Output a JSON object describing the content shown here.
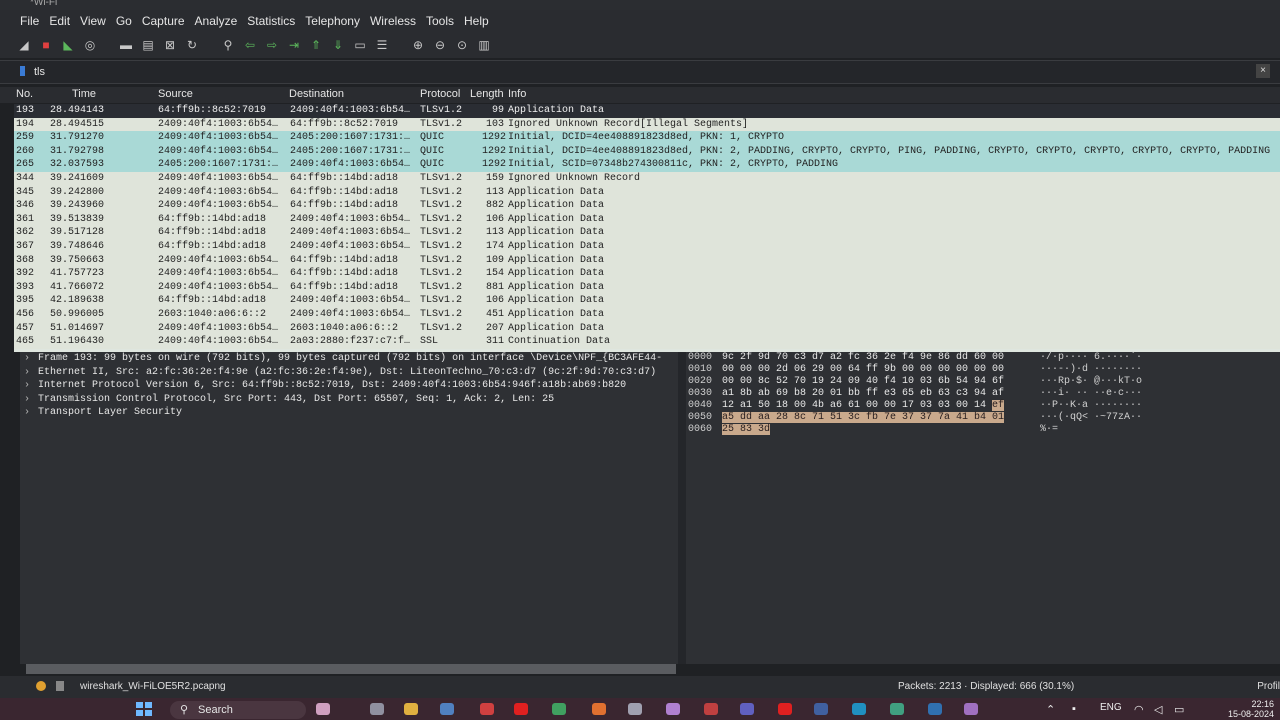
{
  "window": {
    "title": "*Wi-Fi"
  },
  "menu": [
    "File",
    "Edit",
    "View",
    "Go",
    "Capture",
    "Analyze",
    "Statistics",
    "Telephony",
    "Wireless",
    "Tools",
    "Help"
  ],
  "toolbar_icons": [
    "shark-fin-icon",
    "stop-icon",
    "restart-icon",
    "options-icon",
    "open-icon",
    "save-icon",
    "close-file-icon",
    "reload-icon",
    "find-icon",
    "back-icon",
    "forward-icon",
    "goto-icon",
    "first-icon",
    "last-icon",
    "autoscroll-icon",
    "colorize-icon",
    "zoom-in-icon",
    "zoom-out-icon",
    "zoom-reset-icon",
    "resize-columns-icon"
  ],
  "filter": {
    "value": "tls"
  },
  "columns": {
    "no": "No.",
    "time": "Time",
    "source": "Source",
    "destination": "Destination",
    "protocol": "Protocol",
    "length": "Length",
    "info": "Info"
  },
  "packets": [
    {
      "no": "193",
      "time": "28.494143",
      "src": "64:ff9b::8c52:7019",
      "dst": "2409:40f4:1003:6b54…",
      "proto": "TLSv1.2",
      "len": "99",
      "info": "Application Data",
      "type": "sel"
    },
    {
      "no": "194",
      "time": "28.494515",
      "src": "2409:40f4:1003:6b54…",
      "dst": "64:ff9b::8c52:7019",
      "proto": "TLSv1.2",
      "len": "103",
      "info": "Ignored Unknown Record[Illegal Segments]",
      "type": "tls"
    },
    {
      "no": "259",
      "time": "31.791270",
      "src": "2409:40f4:1003:6b54…",
      "dst": "2405:200:1607:1731:…",
      "proto": "QUIC",
      "len": "1292",
      "info": "Initial, DCID=4ee408891823d8ed, PKN: 1, CRYPTO",
      "type": "quic"
    },
    {
      "no": "260",
      "time": "31.792798",
      "src": "2409:40f4:1003:6b54…",
      "dst": "2405:200:1607:1731:…",
      "proto": "QUIC",
      "len": "1292",
      "info": "Initial, DCID=4ee408891823d8ed, PKN: 2, PADDING, CRYPTO, CRYPTO, PING, PADDING, CRYPTO, CRYPTO, CRYPTO, CRYPTO, CRYPTO, PADDING",
      "type": "quic"
    },
    {
      "no": "265",
      "time": "32.037593",
      "src": "2405:200:1607:1731:…",
      "dst": "2409:40f4:1003:6b54…",
      "proto": "QUIC",
      "len": "1292",
      "info": "Initial, SCID=07348b274300811c, PKN: 2, CRYPTO, PADDING",
      "type": "quic"
    },
    {
      "no": "344",
      "time": "39.241609",
      "src": "2409:40f4:1003:6b54…",
      "dst": "64:ff9b::14bd:ad18",
      "proto": "TLSv1.2",
      "len": "159",
      "info": "Ignored Unknown Record",
      "type": "tls"
    },
    {
      "no": "345",
      "time": "39.242800",
      "src": "2409:40f4:1003:6b54…",
      "dst": "64:ff9b::14bd:ad18",
      "proto": "TLSv1.2",
      "len": "113",
      "info": "Application Data",
      "type": "tls"
    },
    {
      "no": "346",
      "time": "39.243960",
      "src": "2409:40f4:1003:6b54…",
      "dst": "64:ff9b::14bd:ad18",
      "proto": "TLSv1.2",
      "len": "882",
      "info": "Application Data",
      "type": "tls"
    },
    {
      "no": "361",
      "time": "39.513839",
      "src": "64:ff9b::14bd:ad18",
      "dst": "2409:40f4:1003:6b54…",
      "proto": "TLSv1.2",
      "len": "106",
      "info": "Application Data",
      "type": "tls"
    },
    {
      "no": "362",
      "time": "39.517128",
      "src": "64:ff9b::14bd:ad18",
      "dst": "2409:40f4:1003:6b54…",
      "proto": "TLSv1.2",
      "len": "113",
      "info": "Application Data",
      "type": "tls"
    },
    {
      "no": "367",
      "time": "39.748646",
      "src": "64:ff9b::14bd:ad18",
      "dst": "2409:40f4:1003:6b54…",
      "proto": "TLSv1.2",
      "len": "174",
      "info": "Application Data",
      "type": "tls"
    },
    {
      "no": "368",
      "time": "39.750663",
      "src": "2409:40f4:1003:6b54…",
      "dst": "64:ff9b::14bd:ad18",
      "proto": "TLSv1.2",
      "len": "109",
      "info": "Application Data",
      "type": "tls"
    },
    {
      "no": "392",
      "time": "41.757723",
      "src": "2409:40f4:1003:6b54…",
      "dst": "64:ff9b::14bd:ad18",
      "proto": "TLSv1.2",
      "len": "154",
      "info": "Application Data",
      "type": "tls"
    },
    {
      "no": "393",
      "time": "41.766072",
      "src": "2409:40f4:1003:6b54…",
      "dst": "64:ff9b::14bd:ad18",
      "proto": "TLSv1.2",
      "len": "881",
      "info": "Application Data",
      "type": "tls"
    },
    {
      "no": "395",
      "time": "42.189638",
      "src": "64:ff9b::14bd:ad18",
      "dst": "2409:40f4:1003:6b54…",
      "proto": "TLSv1.2",
      "len": "106",
      "info": "Application Data",
      "type": "tls"
    },
    {
      "no": "456",
      "time": "50.996005",
      "src": "2603:1040:a06:6::2",
      "dst": "2409:40f4:1003:6b54…",
      "proto": "TLSv1.2",
      "len": "451",
      "info": "Application Data",
      "type": "tls"
    },
    {
      "no": "457",
      "time": "51.014697",
      "src": "2409:40f4:1003:6b54…",
      "dst": "2603:1040:a06:6::2",
      "proto": "TLSv1.2",
      "len": "207",
      "info": "Application Data",
      "type": "tls"
    },
    {
      "no": "465",
      "time": "51.196430",
      "src": "2409:40f4:1003:6b54…",
      "dst": "2a03:2880:f237:c7:f…",
      "proto": "SSL",
      "len": "311",
      "info": "Continuation Data",
      "type": "tls"
    }
  ],
  "details": [
    "Frame 193: 99 bytes on wire (792 bits), 99 bytes captured (792 bits) on interface \\Device\\NPF_{BC3AFE44-",
    "Ethernet II, Src: a2:fc:36:2e:f4:9e (a2:fc:36:2e:f4:9e), Dst: LiteonTechno_70:c3:d7 (9c:2f:9d:70:c3:d7)",
    "Internet Protocol Version 6, Src: 64:ff9b::8c52:7019, Dst: 2409:40f4:1003:6b54:946f:a18b:ab69:b820",
    "Transmission Control Protocol, Src Port: 443, Dst Port: 65507, Seq: 1, Ack: 2, Len: 25",
    "Transport Layer Security"
  ],
  "hex": [
    {
      "off": "0000",
      "a": "9c 2f 9d 70 c3 d7 a2 fc  36 2e f4 9e 86 dd 60 00",
      "h": "",
      "ascii": "·/·p···· 6.····`·"
    },
    {
      "off": "0010",
      "a": "00 00 00 2d 06 29 00 64  ff 9b 00 00 00 00 00 00",
      "h": "",
      "ascii": "···-·)·d ········"
    },
    {
      "off": "0020",
      "a": "00 00 8c 52 70 19 24 09  40 f4 10 03 6b 54 94 6f",
      "h": "",
      "ascii": "···Rp·$· @···kT·o"
    },
    {
      "off": "0030",
      "a": "a1 8b ab 69 b8 20 01 bb  ff e3 65 eb 63 c3 94 af",
      "h": "",
      "ascii": "···i· ·· ··e·c···"
    },
    {
      "off": "0040",
      "a": "12 a1 50 18 00 4b a6 61  00 00 17 03 03 00 14 ",
      "h": "ef",
      "ascii": "··P··K·a ········"
    },
    {
      "off": "0050",
      "a": "",
      "h": "a5 dd aa 28 8c 71 51 3c  fb 7e 37 37 7a 41 b4 01",
      "ascii": "···(·qQ< ·~77zA··"
    },
    {
      "off": "0060",
      "a": "",
      "h": "25 83 3d",
      "ascii": "%·="
    }
  ],
  "status": {
    "file": "wireshark_Wi-FiLOE5R2.pcapng",
    "packets": "Packets: 2213 · Displayed: 666 (30.1%)",
    "profile": "Profil"
  },
  "taskbar": {
    "search": "Search",
    "lang": "ENG",
    "time": "22:16",
    "date": "15-08-2024"
  }
}
